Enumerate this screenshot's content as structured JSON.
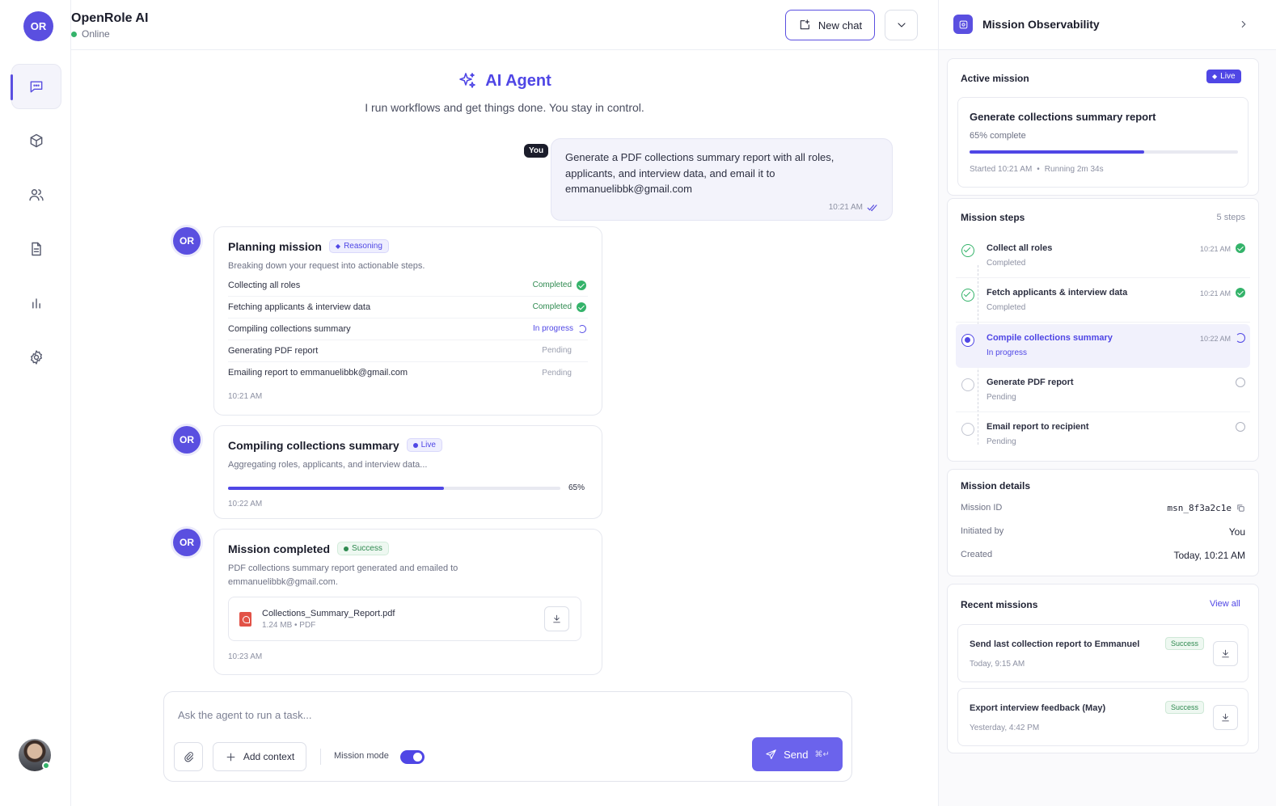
{
  "app": {
    "avatar": "OR",
    "title": "OpenRole AI",
    "status": "Online"
  },
  "header": {
    "new_chat": "New chat"
  },
  "nav": [
    {
      "name": "chat-icon",
      "active": true
    },
    {
      "name": "cube-icon",
      "active": false
    },
    {
      "name": "users-icon",
      "active": false
    },
    {
      "name": "document-icon",
      "active": false
    },
    {
      "name": "chart-icon",
      "active": false
    },
    {
      "name": "gear-icon",
      "active": false
    }
  ],
  "agent": {
    "title": "AI Agent",
    "subtitle": "I run workflows and get things done. You stay in control."
  },
  "user_message": {
    "badge": "You",
    "text": "Generate a PDF collections summary report with all roles, applicants, and interview data, and email it to emmanuelibbk@gmail.com",
    "time": "10:21 AM"
  },
  "planning": {
    "avatar": "OR",
    "title": "Planning mission",
    "badge": "Reasoning",
    "subtitle": "Breaking down your request into actionable steps.",
    "steps": [
      {
        "label": "Collecting all roles",
        "state": "Completed"
      },
      {
        "label": "Fetching applicants & interview data",
        "state": "Completed"
      },
      {
        "label": "Compiling collections summary",
        "state": "In progress"
      },
      {
        "label": "Generating PDF report",
        "state": "Pending"
      },
      {
        "label": "Emailing report to emmanuelibbk@gmail.com",
        "state": "Pending"
      }
    ],
    "time": "10:21 AM"
  },
  "compiling": {
    "avatar": "OR",
    "title": "Compiling collections summary",
    "badge": "Live",
    "subtitle": "Aggregating roles, applicants, and interview data...",
    "progress": 0.65,
    "progress_label": "65%",
    "time": "10:22 AM"
  },
  "completed": {
    "avatar": "OR",
    "title": "Mission completed",
    "badge": "Success",
    "subtitle": "PDF collections summary report generated and emailed to emmanuelibbk@gmail.com.",
    "file": {
      "name": "Collections_Summary_Report.pdf",
      "meta": "1.24 MB • PDF"
    },
    "time": "10:23 AM"
  },
  "composer": {
    "placeholder": "Ask the agent to run a task...",
    "add_context": "Add context",
    "mode_label": "Mission mode",
    "mission_mode": true,
    "send": "Send",
    "shortcut": "⌘↵"
  },
  "panel": {
    "title": "Mission Observability",
    "active": {
      "title": "Active mission",
      "badge": "Live",
      "name": "Generate collections summary report",
      "progress_text": "65% complete",
      "progress": 0.65,
      "started": "Started 10:21 AM",
      "running": "Running 2m 34s"
    },
    "steps": {
      "title": "Mission steps",
      "count": "5 steps",
      "items": [
        {
          "name": "Collect all roles",
          "status": "Completed",
          "time": "10:21 AM",
          "kind": "done"
        },
        {
          "name": "Fetch applicants & interview data",
          "status": "Completed",
          "time": "10:21 AM",
          "kind": "done"
        },
        {
          "name": "Compile collections summary",
          "status": "In progress",
          "time": "10:22 AM",
          "kind": "current"
        },
        {
          "name": "Generate PDF report",
          "status": "Pending",
          "time": "",
          "kind": "pending"
        },
        {
          "name": "Email report to recipient",
          "status": "Pending",
          "time": "",
          "kind": "pending"
        }
      ]
    },
    "details": {
      "title": "Mission details",
      "rows": [
        {
          "label": "Mission ID",
          "value": "msn_8f3a2c1e"
        },
        {
          "label": "Initiated by",
          "value": "You"
        },
        {
          "label": "Created",
          "value": "Today, 10:21 AM"
        }
      ]
    },
    "recent": {
      "title": "Recent missions",
      "view_all": "View all",
      "items": [
        {
          "title": "Send last collection report to Emmanuel",
          "time": "Today, 9:15 AM",
          "badge": "Success"
        },
        {
          "title": "Export interview feedback (May)",
          "time": "Yesterday, 4:42 PM",
          "badge": "Success"
        }
      ]
    }
  },
  "colors": {
    "accent": "#4f46e5",
    "success": "#34b36a"
  }
}
